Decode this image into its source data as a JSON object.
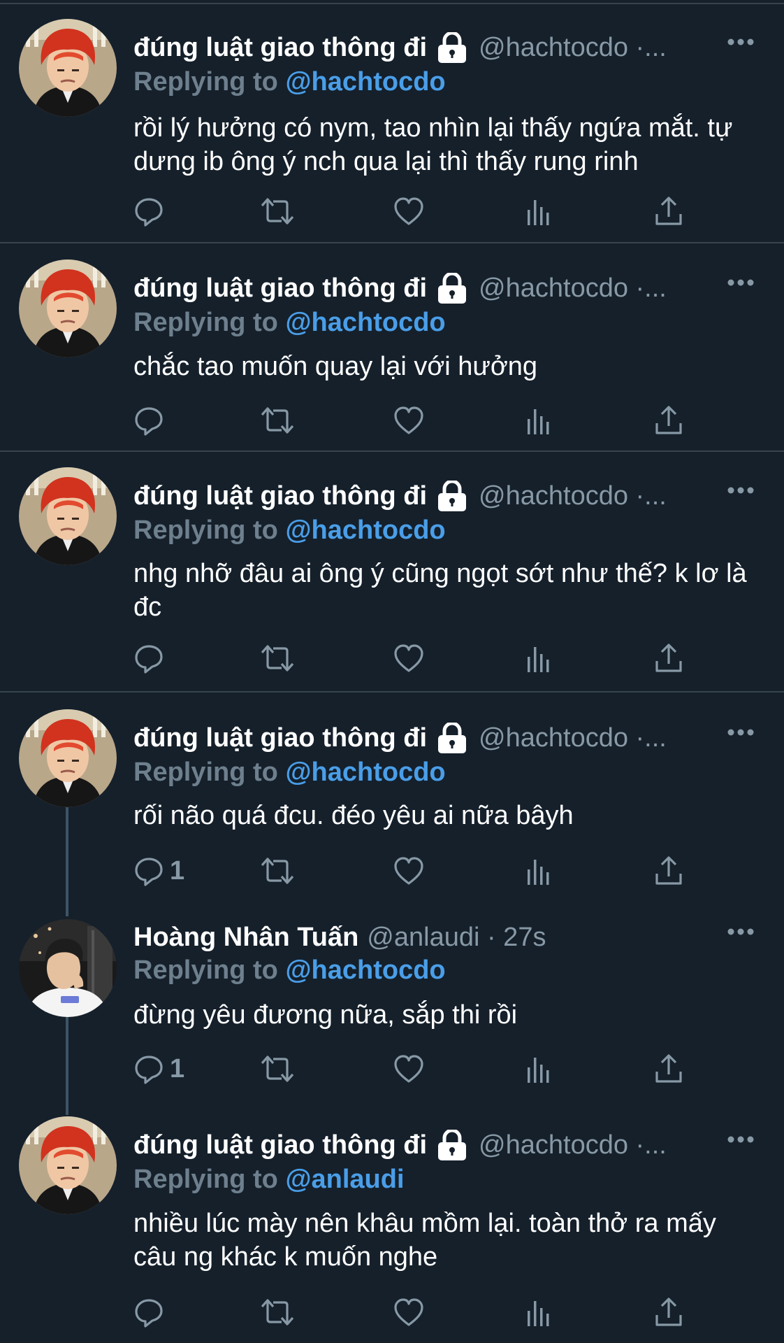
{
  "colors": {
    "background": "#15202b",
    "divider": "#38444d",
    "secondary_text": "#8899a6",
    "mention_blue": "#4a9ee8",
    "thread_line": "#3d5466"
  },
  "tweets": [
    {
      "name": "đúng luật giao thông đi",
      "locked": true,
      "handle": "@hachtocdo ·...",
      "replying_prefix": "Replying to",
      "replying_to": "@hachtocdo",
      "text": "rồi lý hưởng có nym, tao nhìn lại thấy ngứa mắt. tự dưng ib ông ý nch qua lại thì thấy rung rinh",
      "reply_count": "",
      "avatar": "red-hair-avatar"
    },
    {
      "name": "đúng luật giao thông đi",
      "locked": true,
      "handle": "@hachtocdo ·...",
      "replying_prefix": "Replying to",
      "replying_to": "@hachtocdo",
      "text": "chắc tao muốn quay lại với hưởng",
      "reply_count": "",
      "avatar": "red-hair-avatar"
    },
    {
      "name": "đúng luật giao thông đi",
      "locked": true,
      "handle": "@hachtocdo ·...",
      "replying_prefix": "Replying to",
      "replying_to": "@hachtocdo",
      "text": "nhg nhỡ đâu ai ông ý cũng ngọt sớt như thế? k lơ là đc",
      "reply_count": "",
      "avatar": "red-hair-avatar"
    },
    {
      "name": "đúng luật giao thông đi",
      "locked": true,
      "handle": "@hachtocdo ·...",
      "replying_prefix": "Replying to",
      "replying_to": "@hachtocdo",
      "text": "rối não quá đcu. đéo yêu ai nữa bâyh",
      "reply_count": "1",
      "avatar": "red-hair-avatar"
    },
    {
      "name": "Hoàng Nhân Tuấn",
      "locked": false,
      "handle": "@anlaudi · 27s",
      "replying_prefix": "Replying to",
      "replying_to": "@hachtocdo",
      "text": "đừng yêu đương nữa, sắp thi rồi",
      "reply_count": "1",
      "avatar": "boy-white-shirt-avatar"
    },
    {
      "name": "đúng luật giao thông đi",
      "locked": true,
      "handle": "@hachtocdo ·...",
      "replying_prefix": "Replying to",
      "replying_to": "@anlaudi",
      "text": "nhiều lúc mày nên khâu mồm lại. toàn thở ra mấy câu ng khác k muốn nghe",
      "reply_count": "",
      "avatar": "red-hair-avatar"
    }
  ],
  "action_icons": [
    "reply-icon",
    "retweet-icon",
    "like-icon",
    "analytics-icon",
    "share-icon"
  ]
}
